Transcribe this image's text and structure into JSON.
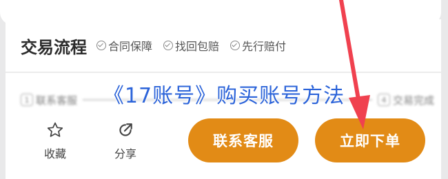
{
  "process": {
    "title": "交易流程",
    "badges": [
      {
        "label": "合同保障",
        "icon": "check-circle-icon"
      },
      {
        "label": "找回包赔",
        "icon": "check-circle-icon"
      },
      {
        "label": "先行赔付",
        "icon": "check-circle-icon"
      }
    ]
  },
  "steps": [
    {
      "num": "1",
      "label": "联系客服"
    },
    {
      "num": "4",
      "label": "交易完成"
    }
  ],
  "overlay": {
    "title": "《17账号》购买账号方法",
    "color": "#2b63d9"
  },
  "bottom_bar": {
    "favorite": {
      "label": "收藏",
      "icon": "star-icon"
    },
    "share": {
      "label": "分享",
      "icon": "share-icon"
    },
    "contact_button": "联系客服",
    "order_button": "立即下单",
    "button_color": "#e28b16"
  },
  "annotation": {
    "arrow_color": "#f0414f",
    "points_to": "order-button"
  }
}
